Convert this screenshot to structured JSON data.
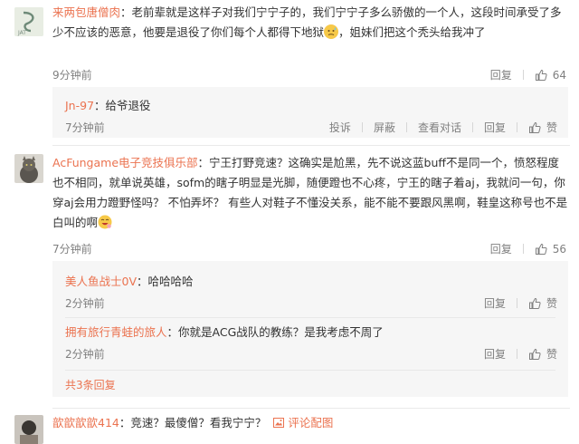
{
  "comments": [
    {
      "username": "来两包唐僧肉",
      "text_a": "：老前辈就是这样子对我们宁宁子的，我们宁宁子多么骄傲的一个人，这段时间承受了多少不应该的恶意，他要是退役了你们每个人都得下地狱",
      "text_b": "，姐妹们把这个秃头给我冲了",
      "time": "9分钟前",
      "reply_label": "回复",
      "like_count": "64",
      "replies": [
        {
          "username": "Jn-97",
          "text": "：给爷退役",
          "time": "7分钟前",
          "actions": [
            "投诉",
            "屏蔽",
            "查看对话",
            "回复"
          ],
          "like_label": "赞"
        }
      ]
    },
    {
      "username": "AcFungame电子竞技俱乐部",
      "text_a": "：宁王打野竞速？这确实是尬黑，先不说这蓝buff不是同一个，愤怒程度也不相同，就单说英雄，sofm的瞎子明显是光脚，随便蹬也不心疼，宁王的瞎子着aj，我就问一句，你穿aj会用力蹬野怪吗？ 不怕弄坏？ 有些人对鞋子不懂没关系，能不能不要跟风黑啊，鞋皇这称号也不是白叫的啊",
      "time": "7分钟前",
      "reply_label": "回复",
      "like_count": "56",
      "replies": [
        {
          "username": "美人鱼战士0V",
          "text": "：哈哈哈哈",
          "time": "2分钟前",
          "actions": [
            "回复"
          ],
          "like_label": "赞"
        },
        {
          "username": "拥有旅行青蛙的旅人",
          "text": "：你就是ACG战队的教练？是我考虑不周了",
          "time": "2分钟前",
          "actions": [
            "回复"
          ],
          "like_label": "赞"
        }
      ],
      "more_replies": "共3条回复"
    },
    {
      "username": "歆歆歆歆414",
      "text": "：竞速？最傻僧？看我宁宁？",
      "comment_link": "评论配图"
    }
  ],
  "colors": {
    "username": "#eb7350",
    "meta": "#808080",
    "reply_bg": "#f6f6f6"
  }
}
